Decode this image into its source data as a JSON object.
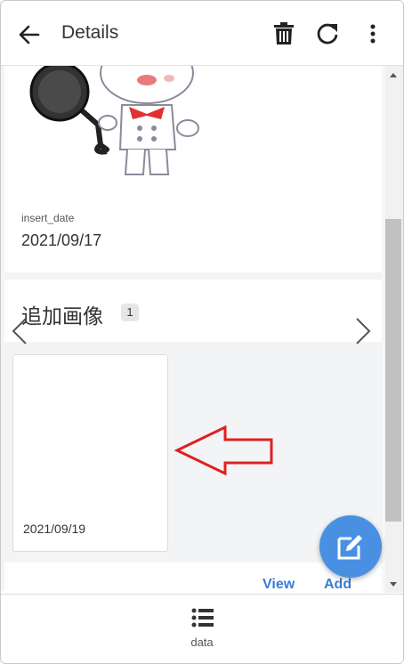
{
  "appbar": {
    "title": "Details",
    "back_icon": "arrow-left-icon",
    "actions": [
      "trash-icon",
      "refresh-icon",
      "more-vert-icon"
    ]
  },
  "record": {
    "insert_date_label": "insert_date",
    "insert_date_value": "2021/09/17"
  },
  "additional_images": {
    "title": "追加画像",
    "count": "1",
    "items": [
      {
        "date": "2021/09/19"
      }
    ]
  },
  "actions": {
    "view_label": "View",
    "add_label": "Add"
  },
  "bottom_nav": {
    "items": [
      {
        "label": "data",
        "icon": "list-icon"
      }
    ]
  },
  "colors": {
    "accent": "#3b7bd4",
    "fab": "#4a90e2",
    "arrow": "#e02020",
    "background": "#f3f4f6"
  }
}
